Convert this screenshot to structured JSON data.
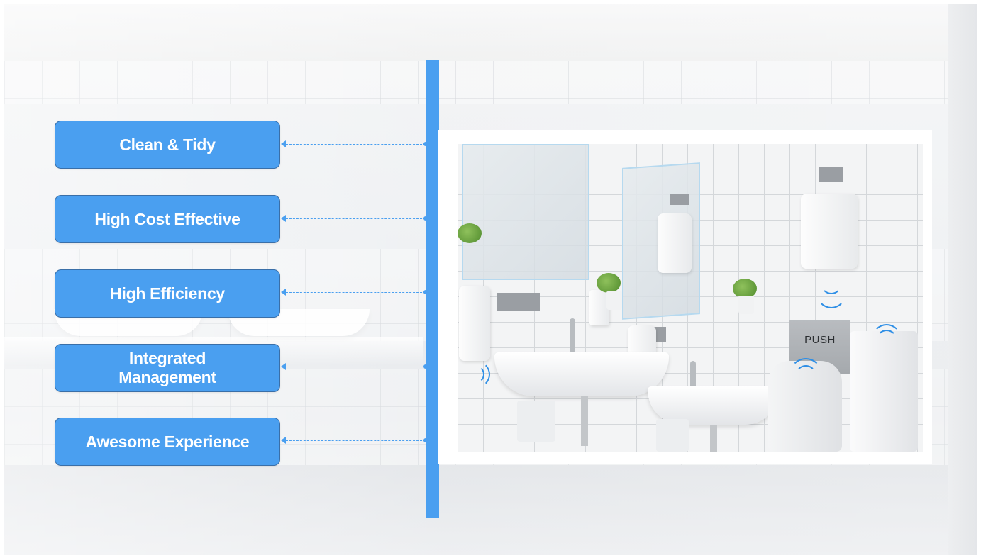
{
  "features": [
    {
      "label": "Clean & Tidy"
    },
    {
      "label": "High Cost Effective"
    },
    {
      "label": "High Efficiency"
    },
    {
      "label": "Integrated\nManagement"
    },
    {
      "label": "Awesome Experience"
    }
  ],
  "photo": {
    "push_sign": "PUSH"
  },
  "colors": {
    "accent": "#4a9ff0",
    "box_border": "#3a6fa8",
    "sensor_wave": "#2f8fe6"
  },
  "icons": [
    "sensor-wave-icon",
    "arrow-left-icon"
  ]
}
